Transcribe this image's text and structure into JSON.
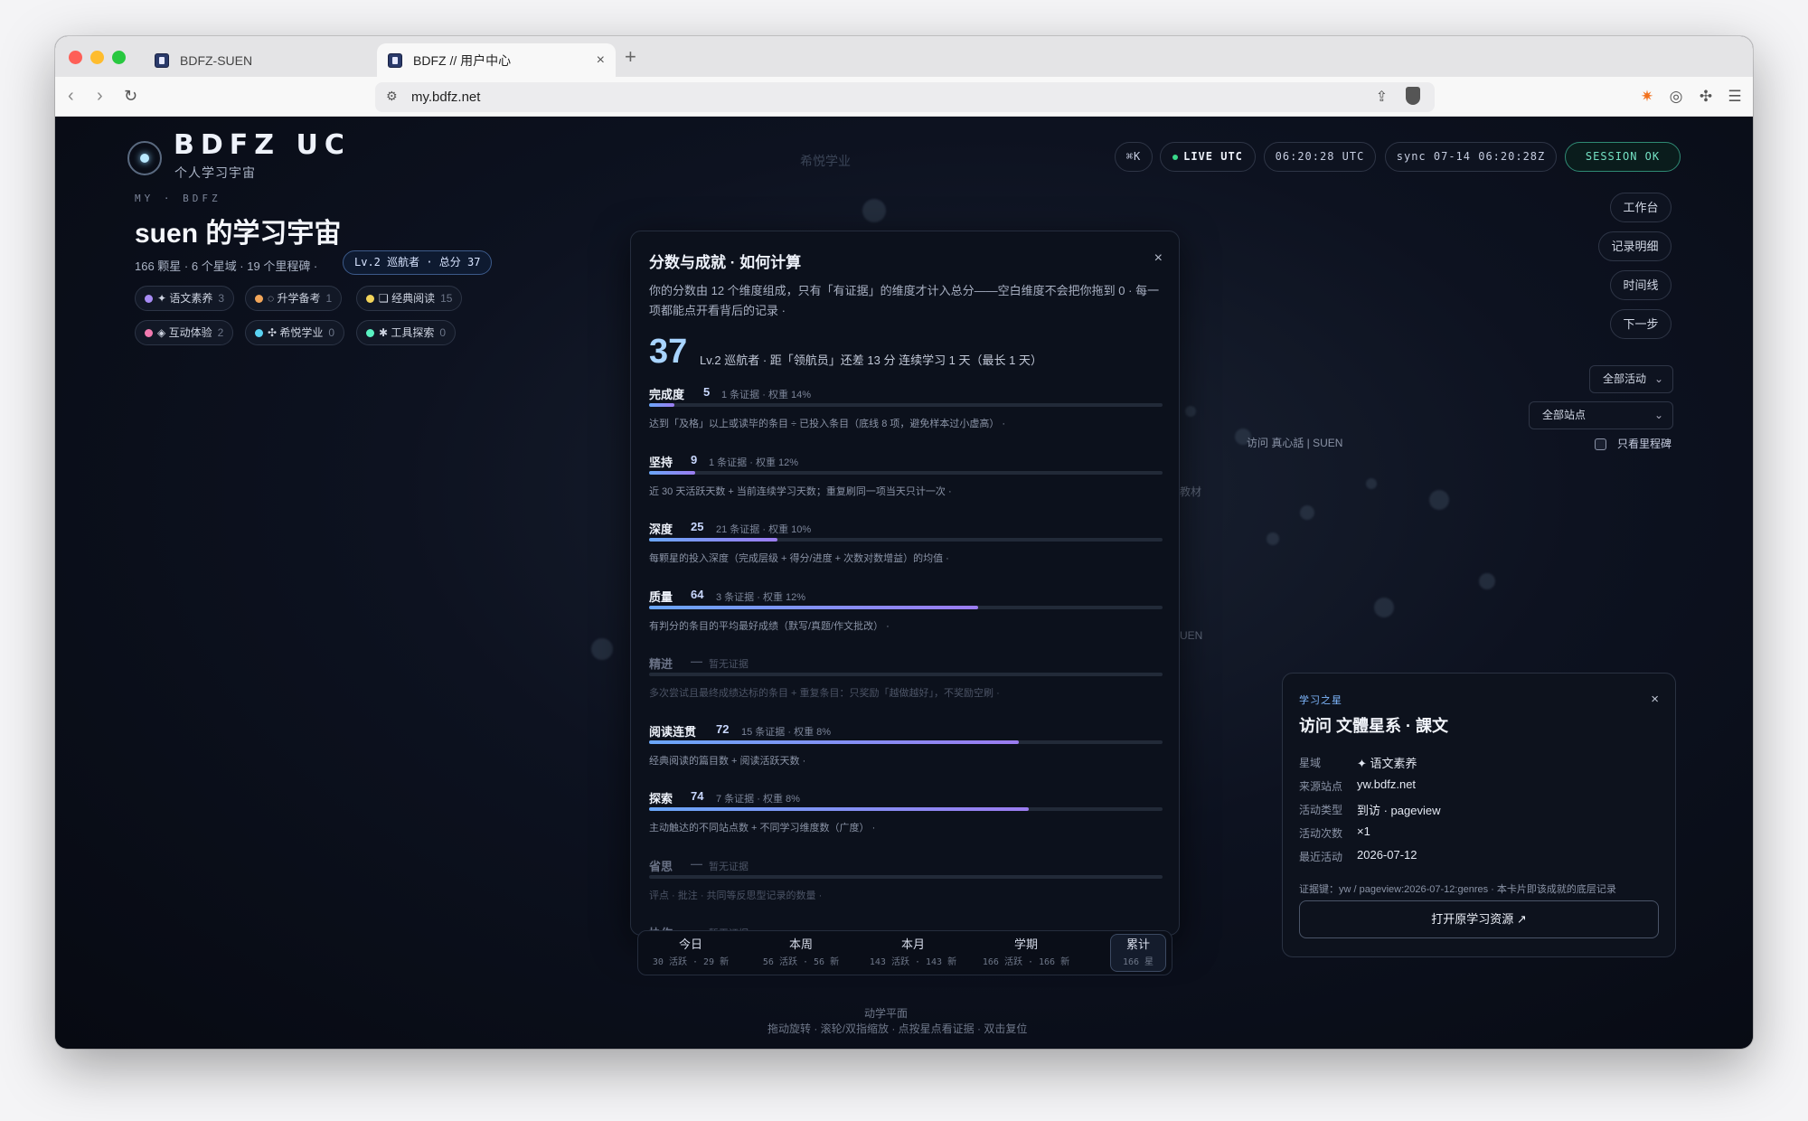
{
  "browser": {
    "tabs": [
      {
        "title": "BDFZ-SUEN"
      },
      {
        "title": "BDFZ // 用户中心"
      }
    ],
    "url": "my.bdfz.net"
  },
  "header": {
    "brand": "BDFZ UC",
    "brand_sub": "个人学习宇宙",
    "crumb": "MY · BDFZ",
    "title": "suen 的学习宇宙",
    "stats": "166 颗星 · 6 个星域 · 19 个里程碑 ·",
    "level_badge": "Lv.2 巡航者 · 总分 37"
  },
  "chips": [
    {
      "label": "✦ 语文素养",
      "count": "3",
      "color": "#a88cf5"
    },
    {
      "label": "◌ 升学备考",
      "count": "1",
      "color": "#f2a65a"
    },
    {
      "label": "❏ 经典阅读",
      "count": "15",
      "color": "#f2d45a"
    },
    {
      "label": "◈ 互动体验",
      "count": "2",
      "color": "#f27ab0"
    },
    {
      "label": "✣ 希悦学业",
      "count": "0",
      "color": "#5ad2f2"
    },
    {
      "label": "✱ 工具探索",
      "count": "0",
      "color": "#5af2c2"
    }
  ],
  "status": {
    "shortcut": "⌘K",
    "live": "LIVE UTC",
    "clock": "06:20:28 UTC",
    "sync": "sync 07-14 06:20:28Z",
    "session": "SESSION OK"
  },
  "side_buttons": [
    "工作台",
    "记录明细",
    "时间线",
    "下一步"
  ],
  "filters": {
    "activity": "全部活动",
    "site": "全部站点",
    "milestone_only": "只看里程碑"
  },
  "background_labels": {
    "top": "希悦学业",
    "mid": "访问 真心話 | SUEN",
    "left1": "教材",
    "left2": "UEN",
    "bottom": "动学平面"
  },
  "score_modal": {
    "title": "分数与成就 · 如何计算",
    "close": "×",
    "intro": "你的分数由 12 个维度组成，只有「有证据」的维度才计入总分——空白维度不会把你拖到 0 · 每一项都能点开看背后的记录 ·",
    "total": "37",
    "total_desc": "Lv.2 巡航者 · 距「领航员」还差 13 分   连续学习 1 天（最长 1 天）",
    "dimensions": [
      {
        "name": "完成度",
        "score": "5",
        "value": 5,
        "meta": "1 条证据 · 权重 14%",
        "desc": "达到「及格」以上或读毕的条目 ÷ 已投入条目（底线 8 项，避免样本过小虚高） ·"
      },
      {
        "name": "坚持",
        "score": "9",
        "value": 9,
        "meta": "1 条证据 · 权重 12%",
        "desc": "近 30 天活跃天数 + 当前连续学习天数；重复刷同一项当天只计一次 ·"
      },
      {
        "name": "深度",
        "score": "25",
        "value": 25,
        "meta": "21 条证据 · 权重 10%",
        "desc": "每颗星的投入深度（完成层级 + 得分/进度 + 次数对数增益）的均值 ·"
      },
      {
        "name": "质量",
        "score": "64",
        "value": 64,
        "meta": "3 条证据 · 权重 12%",
        "desc": "有判分的条目的平均最好成绩（默写/真题/作文批改） ·"
      },
      {
        "name": "精进",
        "score": "—",
        "value": 0,
        "meta": "暂无证据",
        "desc": "多次尝试且最终成绩达标的条目 + 重复条目：只奖励「越做越好」，不奖励空刷 ·"
      },
      {
        "name": "阅读连贯",
        "score": "72",
        "value": 72,
        "meta": "15 条证据 · 权重 8%",
        "desc": "经典阅读的篇目数 + 阅读活跃天数 ·"
      },
      {
        "name": "探索",
        "score": "74",
        "value": 74,
        "meta": "7 条证据 · 权重 8%",
        "desc": "主动触达的不同站点数 + 不同学习维度数（广度） ·"
      },
      {
        "name": "省思",
        "score": "—",
        "value": 0,
        "meta": "暂无证据",
        "desc": "评点 · 批注 · 共同等反思型记录的数量 ·"
      },
      {
        "name": "协作",
        "score": "—",
        "value": 0,
        "meta": "暂无证据",
        "desc": ""
      }
    ]
  },
  "time_filter": [
    {
      "label": "今日",
      "sub": "30 活跃 · 29 新"
    },
    {
      "label": "本周",
      "sub": "56 活跃 · 56 新"
    },
    {
      "label": "本月",
      "sub": "143 活跃 · 143 新"
    },
    {
      "label": "学期",
      "sub": "166 活跃 · 166 新"
    },
    {
      "label": "累计",
      "sub": "166 星"
    }
  ],
  "hint": "拖动旋转 · 滚轮/双指缩放 · 点按星点看证据 · 双击复位",
  "star_card": {
    "eyebrow": "学习之星",
    "title": "访问 文體星系 · 課文",
    "close": "×",
    "rows": [
      {
        "key": "星域",
        "value": "✦ 语文素养"
      },
      {
        "key": "来源站点",
        "value": "yw.bdfz.net"
      },
      {
        "key": "活动类型",
        "value": "到访 · pageview"
      },
      {
        "key": "活动次数",
        "value": "×1"
      },
      {
        "key": "最近活动",
        "value": "2026-07-12"
      }
    ],
    "evidence": "证据键：yw / pageview:2026-07-12:genres · 本卡片即该成就的底层记录",
    "open_button": "打开原学习资源 ↗"
  }
}
